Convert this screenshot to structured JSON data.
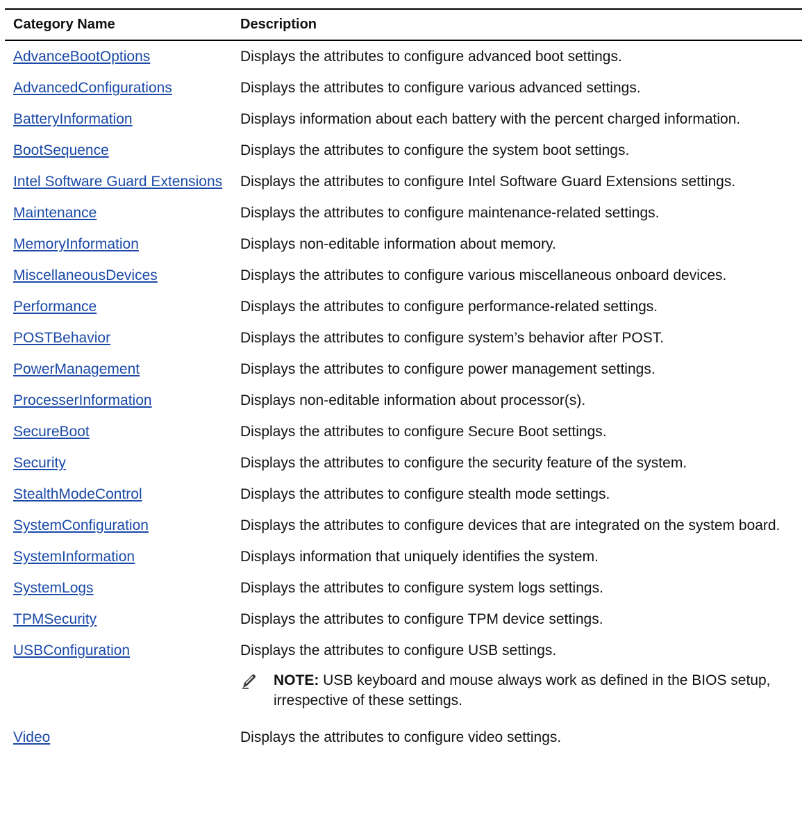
{
  "table": {
    "headers": {
      "category": "Category Name",
      "description": "Description"
    },
    "rows": [
      {
        "category": "AdvanceBootOptions",
        "description": "Displays the attributes to configure advanced boot settings."
      },
      {
        "category": "AdvancedConfigurations",
        "description": "Displays the attributes to configure various advanced settings."
      },
      {
        "category": "BatteryInformation",
        "description": "Displays information about each battery with the percent charged information."
      },
      {
        "category": "BootSequence",
        "description": "Displays the attributes to configure the system boot settings."
      },
      {
        "category": "Intel Software Guard Extensions",
        "description": "Displays the attributes to configure Intel Software Guard Extensions settings."
      },
      {
        "category": "Maintenance",
        "description": "Displays the attributes to configure maintenance-related settings."
      },
      {
        "category": "MemoryInformation",
        "description": "Displays non-editable information about memory."
      },
      {
        "category": "MiscellaneousDevices",
        "description": "Displays the attributes to configure various miscellaneous onboard devices."
      },
      {
        "category": "Performance",
        "description": "Displays the attributes to configure performance-related settings."
      },
      {
        "category": "POSTBehavior",
        "description": "Displays the attributes to configure system’s behavior after POST."
      },
      {
        "category": "PowerManagement",
        "description": "Displays the attributes to configure power management settings."
      },
      {
        "category": "ProcesserInformation",
        "description": "Displays non-editable information about processor(s)."
      },
      {
        "category": "SecureBoot",
        "description": "Displays the attributes to configure Secure Boot settings."
      },
      {
        "category": "Security",
        "description": "Displays the attributes to configure the security feature of the system."
      },
      {
        "category": "StealthModeControl",
        "description": "Displays the attributes to configure stealth mode settings."
      },
      {
        "category": "SystemConfiguration",
        "description": "Displays the attributes to configure devices that are integrated on the system board."
      },
      {
        "category": "SystemInformation",
        "description": "Displays information that uniquely identifies the system."
      },
      {
        "category": "SystemLogs",
        "description": "Displays the attributes to configure system logs settings."
      },
      {
        "category": "TPMSecurity",
        "description": "Displays the attributes to configure TPM device settings."
      },
      {
        "category": "USBConfiguration",
        "description": "Displays the attributes to configure USB settings.",
        "note": {
          "label": "NOTE:",
          "text": " USB keyboard and mouse always work as defined in the BIOS setup, irrespective of these settings.",
          "icon": "pencil-icon"
        }
      },
      {
        "category": "Video",
        "description": "Displays the attributes to configure video settings."
      }
    ]
  },
  "colors": {
    "link": "#1a49a8",
    "text": "#111111",
    "rule": "#000000"
  }
}
